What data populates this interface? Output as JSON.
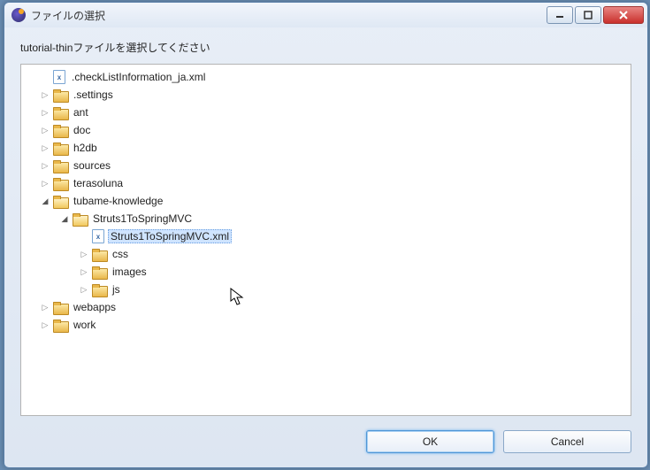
{
  "window": {
    "title": "ファイルの選択"
  },
  "instruction": "tutorial-thinファイルを選択してください",
  "tree": {
    "items": [
      {
        "depth": 0,
        "expander": "blank",
        "icon": "file",
        "label": ".checkListInformation_ja.xml",
        "selected": false
      },
      {
        "depth": 0,
        "expander": "closed",
        "icon": "folder",
        "label": ".settings",
        "selected": false
      },
      {
        "depth": 0,
        "expander": "closed",
        "icon": "folder",
        "label": "ant",
        "selected": false
      },
      {
        "depth": 0,
        "expander": "closed",
        "icon": "folder",
        "label": "doc",
        "selected": false
      },
      {
        "depth": 0,
        "expander": "closed",
        "icon": "folder",
        "label": "h2db",
        "selected": false
      },
      {
        "depth": 0,
        "expander": "closed",
        "icon": "folder",
        "label": "sources",
        "selected": false
      },
      {
        "depth": 0,
        "expander": "closed",
        "icon": "folder",
        "label": "terasoluna",
        "selected": false
      },
      {
        "depth": 0,
        "expander": "open",
        "icon": "folder-open",
        "label": "tubame-knowledge",
        "selected": false
      },
      {
        "depth": 1,
        "expander": "open",
        "icon": "folder-open",
        "label": "Struts1ToSpringMVC",
        "selected": false
      },
      {
        "depth": 2,
        "expander": "blank",
        "icon": "file",
        "label": "Struts1ToSpringMVC.xml",
        "selected": true
      },
      {
        "depth": 2,
        "expander": "closed",
        "icon": "folder",
        "label": "css",
        "selected": false
      },
      {
        "depth": 2,
        "expander": "closed",
        "icon": "folder",
        "label": "images",
        "selected": false
      },
      {
        "depth": 2,
        "expander": "closed",
        "icon": "folder",
        "label": "js",
        "selected": false
      },
      {
        "depth": 0,
        "expander": "closed",
        "icon": "folder",
        "label": "webapps",
        "selected": false
      },
      {
        "depth": 0,
        "expander": "closed",
        "icon": "folder",
        "label": "work",
        "selected": false
      }
    ]
  },
  "buttons": {
    "ok": "OK",
    "cancel": "Cancel"
  },
  "icons": {
    "file_glyph": "x"
  }
}
